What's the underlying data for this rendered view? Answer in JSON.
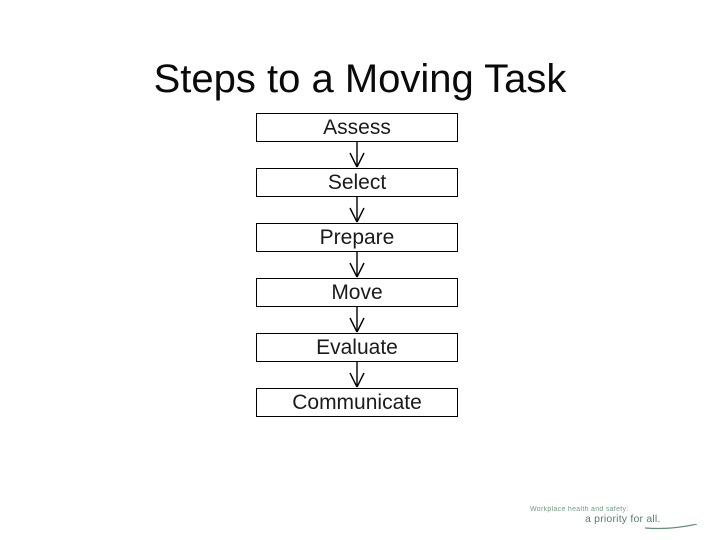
{
  "slide": {
    "title": "Steps to a Moving Task",
    "background_color": "#ffffff",
    "text_color": "#0a0a0a"
  },
  "flowchart": {
    "orientation": "vertical",
    "connector": "down-arrow",
    "box_border_color": "#000000",
    "box_fill_color": "#ffffff",
    "steps": [
      {
        "label": "Assess"
      },
      {
        "label": "Select"
      },
      {
        "label": "Prepare"
      },
      {
        "label": "Move"
      },
      {
        "label": "Evaluate"
      },
      {
        "label": "Communicate"
      }
    ]
  },
  "footer_logo": {
    "line1": "Workplace health and safety:",
    "line2": "a priority for all.",
    "color": "#4a7a5e"
  }
}
